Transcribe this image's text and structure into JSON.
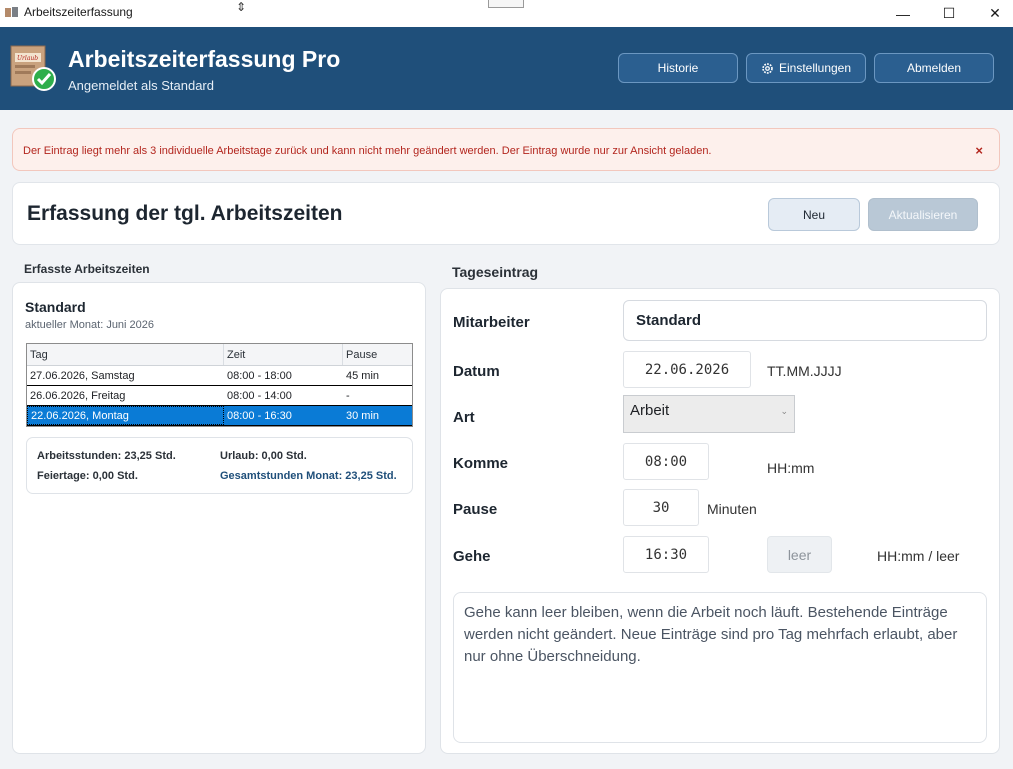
{
  "window": {
    "title": "Arbeitszeiterfassung",
    "minimize": "—",
    "maximize": "☐",
    "close": "✕"
  },
  "header": {
    "title": "Arbeitszeiterfassung Pro",
    "subtitle": "Angemeldet als Standard",
    "buttons": {
      "history": "Historie",
      "settings": "Einstellungen",
      "logout": "Abmelden"
    },
    "colors": {
      "bar": "#1f4f7a",
      "button": "#2b5f90"
    }
  },
  "alert": {
    "message": "Der Eintrag liegt mehr als 3 individuelle Arbeitstage zurück und kann nicht mehr geändert werden. Der Eintrag wurde nur zur Ansicht geladen.",
    "close": "×"
  },
  "section": {
    "title": "Erfassung der tgl. Arbeitszeiten",
    "new_button": "Neu",
    "update_button": "Aktualisieren"
  },
  "left": {
    "label": "Erfasste Arbeitszeiten",
    "employee": "Standard",
    "month": "aktueller Monat: Juni 2026",
    "columns": [
      "Tag",
      "Zeit",
      "Pause"
    ],
    "rows": [
      {
        "day": "27.06.2026, Samstag",
        "time": "08:00 - 18:00",
        "pause": "45 min",
        "selected": false
      },
      {
        "day": "26.06.2026, Freitag",
        "time": "08:00 - 14:00",
        "pause": "-",
        "selected": false
      },
      {
        "day": "22.06.2026, Montag",
        "time": "08:00 - 16:30",
        "pause": "30 min",
        "selected": true
      }
    ],
    "summary": {
      "work_hours": "Arbeitsstunden: 23,25 Std.",
      "vacation": "Urlaub: 0,00 Std.",
      "holidays": "Feiertage: 0,00 Std.",
      "total_month": "Gesamtstunden Monat: 23,25 Std."
    }
  },
  "right": {
    "label": "Tageseintrag",
    "fields": {
      "employee_label": "Mitarbeiter",
      "employee_value": "Standard",
      "date_label": "Datum",
      "date_value": "22.06.2026",
      "date_hint": "TT.MM.JJJJ",
      "type_label": "Art",
      "type_value": "Arbeit",
      "arrive_label": "Komme",
      "arrive_value": "08:00",
      "arrive_hint": "HH:mm",
      "pause_label": "Pause",
      "pause_value": "30",
      "pause_hint": "Minuten",
      "leave_label": "Gehe",
      "leave_value": "16:30",
      "leave_empty_button": "leer",
      "leave_hint": "HH:mm / leer"
    },
    "info": "Gehe kann leer bleiben, wenn die Arbeit noch läuft. Bestehende Einträge werden nicht geändert. Neue Einträge sind pro Tag mehrfach erlaubt, aber nur ohne Überschneidung."
  }
}
